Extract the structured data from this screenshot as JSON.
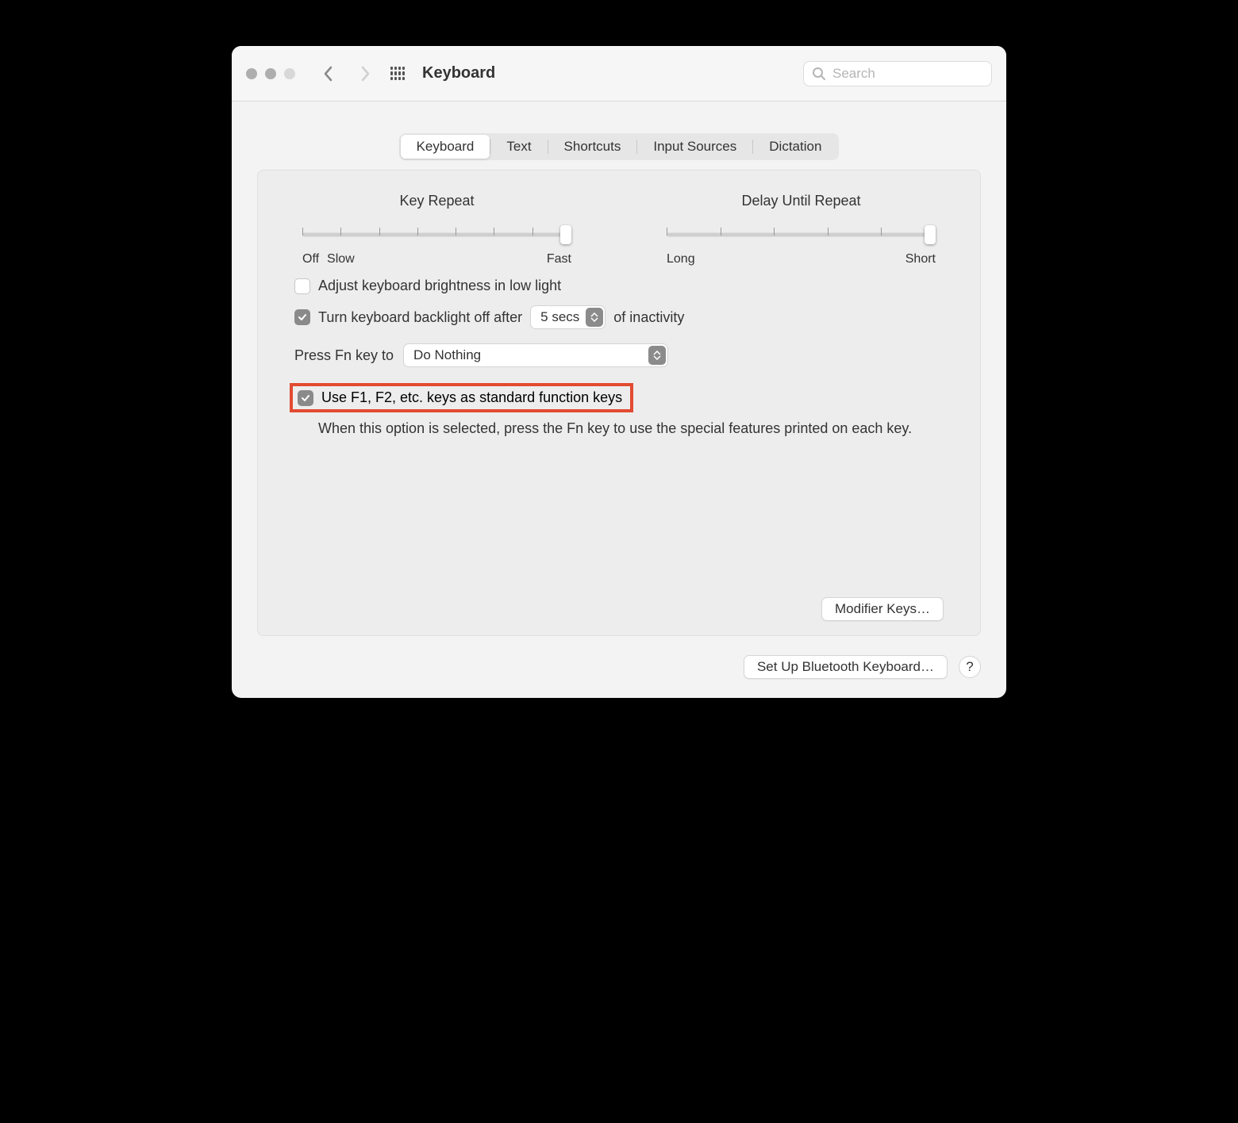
{
  "header": {
    "title": "Keyboard",
    "search_placeholder": "Search"
  },
  "tabs": [
    "Keyboard",
    "Text",
    "Shortcuts",
    "Input Sources",
    "Dictation"
  ],
  "active_tab": "Keyboard",
  "slider1": {
    "title": "Key Repeat",
    "left1": "Off",
    "left2": "Slow",
    "right": "Fast"
  },
  "slider2": {
    "title": "Delay Until Repeat",
    "left": "Long",
    "right": "Short"
  },
  "options": {
    "adjust_brightness": "Adjust keyboard brightness in low light",
    "backlight_off_pre": "Turn keyboard backlight off after",
    "backlight_off_post": "of inactivity",
    "backlight_value": "5 secs",
    "fn_label": "Press Fn key to",
    "fn_value": "Do Nothing",
    "std_fn_keys": "Use F1, F2, etc. keys as standard function keys",
    "std_fn_desc": "When this option is selected, press the Fn key to use the special features printed on each key."
  },
  "buttons": {
    "modifier": "Modifier Keys…",
    "bluetooth": "Set Up Bluetooth Keyboard…",
    "help": "?"
  }
}
